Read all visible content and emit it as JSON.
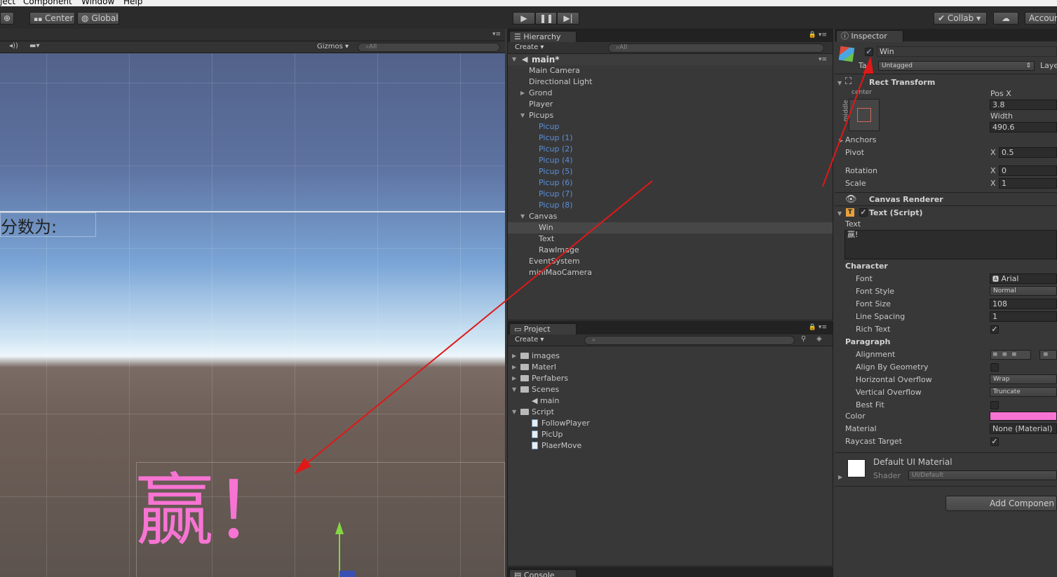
{
  "menu": {
    "items": [
      "ject",
      "Component",
      "Window",
      "Help"
    ]
  },
  "toolbar": {
    "center_label": "Center",
    "global_label": "Global",
    "collab_label": "Collab ▾",
    "account_label": "Accoun"
  },
  "scene": {
    "gizmos_label": "Gizmos",
    "search_placeholder": "All",
    "score_text": "分数为:",
    "win_text": "赢！",
    "win_color": "#f774d3"
  },
  "hierarchy": {
    "tab_label": "Hierarchy",
    "create_label": "Create ▾",
    "search_placeholder": "All",
    "scene_name": "main*",
    "items": [
      {
        "label": "Main Camera",
        "indent": 0,
        "fold": "",
        "prefab": false,
        "selected": false
      },
      {
        "label": "Directional Light",
        "indent": 0,
        "fold": "",
        "prefab": false,
        "selected": false
      },
      {
        "label": "Grond",
        "indent": 0,
        "fold": "▶",
        "prefab": false,
        "selected": false
      },
      {
        "label": "Player",
        "indent": 0,
        "fold": "",
        "prefab": false,
        "selected": false
      },
      {
        "label": "Picups",
        "indent": 0,
        "fold": "▼",
        "prefab": false,
        "selected": false
      },
      {
        "label": "Picup",
        "indent": 1,
        "fold": "",
        "prefab": true,
        "selected": false
      },
      {
        "label": "Picup (1)",
        "indent": 1,
        "fold": "",
        "prefab": true,
        "selected": false
      },
      {
        "label": "Picup (2)",
        "indent": 1,
        "fold": "",
        "prefab": true,
        "selected": false
      },
      {
        "label": "Picup (4)",
        "indent": 1,
        "fold": "",
        "prefab": true,
        "selected": false
      },
      {
        "label": "Picup (5)",
        "indent": 1,
        "fold": "",
        "prefab": true,
        "selected": false
      },
      {
        "label": "Picup (6)",
        "indent": 1,
        "fold": "",
        "prefab": true,
        "selected": false
      },
      {
        "label": "Picup (7)",
        "indent": 1,
        "fold": "",
        "prefab": true,
        "selected": false
      },
      {
        "label": "Picup (8)",
        "indent": 1,
        "fold": "",
        "prefab": true,
        "selected": false
      },
      {
        "label": "Canvas",
        "indent": 0,
        "fold": "▼",
        "prefab": false,
        "selected": false
      },
      {
        "label": "Win",
        "indent": 1,
        "fold": "",
        "prefab": false,
        "selected": true
      },
      {
        "label": "Text",
        "indent": 1,
        "fold": "",
        "prefab": false,
        "selected": false
      },
      {
        "label": "RawImage",
        "indent": 1,
        "fold": "",
        "prefab": false,
        "selected": false
      },
      {
        "label": "EventSystem",
        "indent": 0,
        "fold": "",
        "prefab": false,
        "selected": false
      },
      {
        "label": "miniMaoCamera",
        "indent": 0,
        "fold": "",
        "prefab": false,
        "selected": false
      }
    ]
  },
  "project": {
    "tab_label": "Project",
    "create_label": "Create ▾",
    "items": [
      {
        "label": "images",
        "indent": 0,
        "fold": "▶",
        "type": "folder"
      },
      {
        "label": "Materl",
        "indent": 0,
        "fold": "▶",
        "type": "folder"
      },
      {
        "label": "Perfabers",
        "indent": 0,
        "fold": "▶",
        "type": "folder"
      },
      {
        "label": "Scenes",
        "indent": 0,
        "fold": "▼",
        "type": "folder"
      },
      {
        "label": "main",
        "indent": 1,
        "fold": "",
        "type": "scene"
      },
      {
        "label": "Script",
        "indent": 0,
        "fold": "▼",
        "type": "folder"
      },
      {
        "label": "FollowPlayer",
        "indent": 1,
        "fold": "",
        "type": "script"
      },
      {
        "label": "PicUp",
        "indent": 1,
        "fold": "",
        "type": "script"
      },
      {
        "label": "PlaerMove",
        "indent": 1,
        "fold": "",
        "type": "script"
      }
    ]
  },
  "console": {
    "tab_label": "Console"
  },
  "inspector": {
    "tab_label": "Inspector",
    "object_name": "Win",
    "tag_label": "Tag",
    "tag_value": "Untagged",
    "layer_label": "Laye",
    "rect_transform": {
      "title": "Rect Transform",
      "anchor_h": "center",
      "anchor_v": "middle",
      "posx_label": "Pos X",
      "posx_value": "3.8",
      "width_label": "Width",
      "width_value": "490.6",
      "anchors_label": "Anchors",
      "pivot_label": "Pivot",
      "pivot_x": "0.5",
      "rotation_label": "Rotation",
      "rotation_x": "0",
      "scale_label": "Scale",
      "scale_x": "1",
      "x_label": "X"
    },
    "canvas_renderer": {
      "title": "Canvas Renderer"
    },
    "text_script": {
      "title": "Text (Script)",
      "text_label": "Text",
      "text_value": "赢!",
      "character_label": "Character",
      "font_label": "Font",
      "font_value": "Arial",
      "font_style_label": "Font Style",
      "font_style_value": "Normal",
      "font_size_label": "Font Size",
      "font_size_value": "108",
      "line_spacing_label": "Line Spacing",
      "line_spacing_value": "1",
      "rich_text_label": "Rich Text",
      "paragraph_label": "Paragraph",
      "alignment_label": "Alignment",
      "align_geometry_label": "Align By Geometry",
      "h_overflow_label": "Horizontal Overflow",
      "h_overflow_value": "Wrap",
      "v_overflow_label": "Vertical Overflow",
      "v_overflow_value": "Truncate",
      "best_fit_label": "Best Fit",
      "color_label": "Color",
      "color_value": "#f774d3",
      "material_label": "Material",
      "material_value": "None (Material)",
      "raycast_label": "Raycast Target"
    },
    "material": {
      "name": "Default UI Material",
      "shader_label": "Shader",
      "shader_value": "UI/Default"
    },
    "add_component_label": "Add Componen"
  }
}
